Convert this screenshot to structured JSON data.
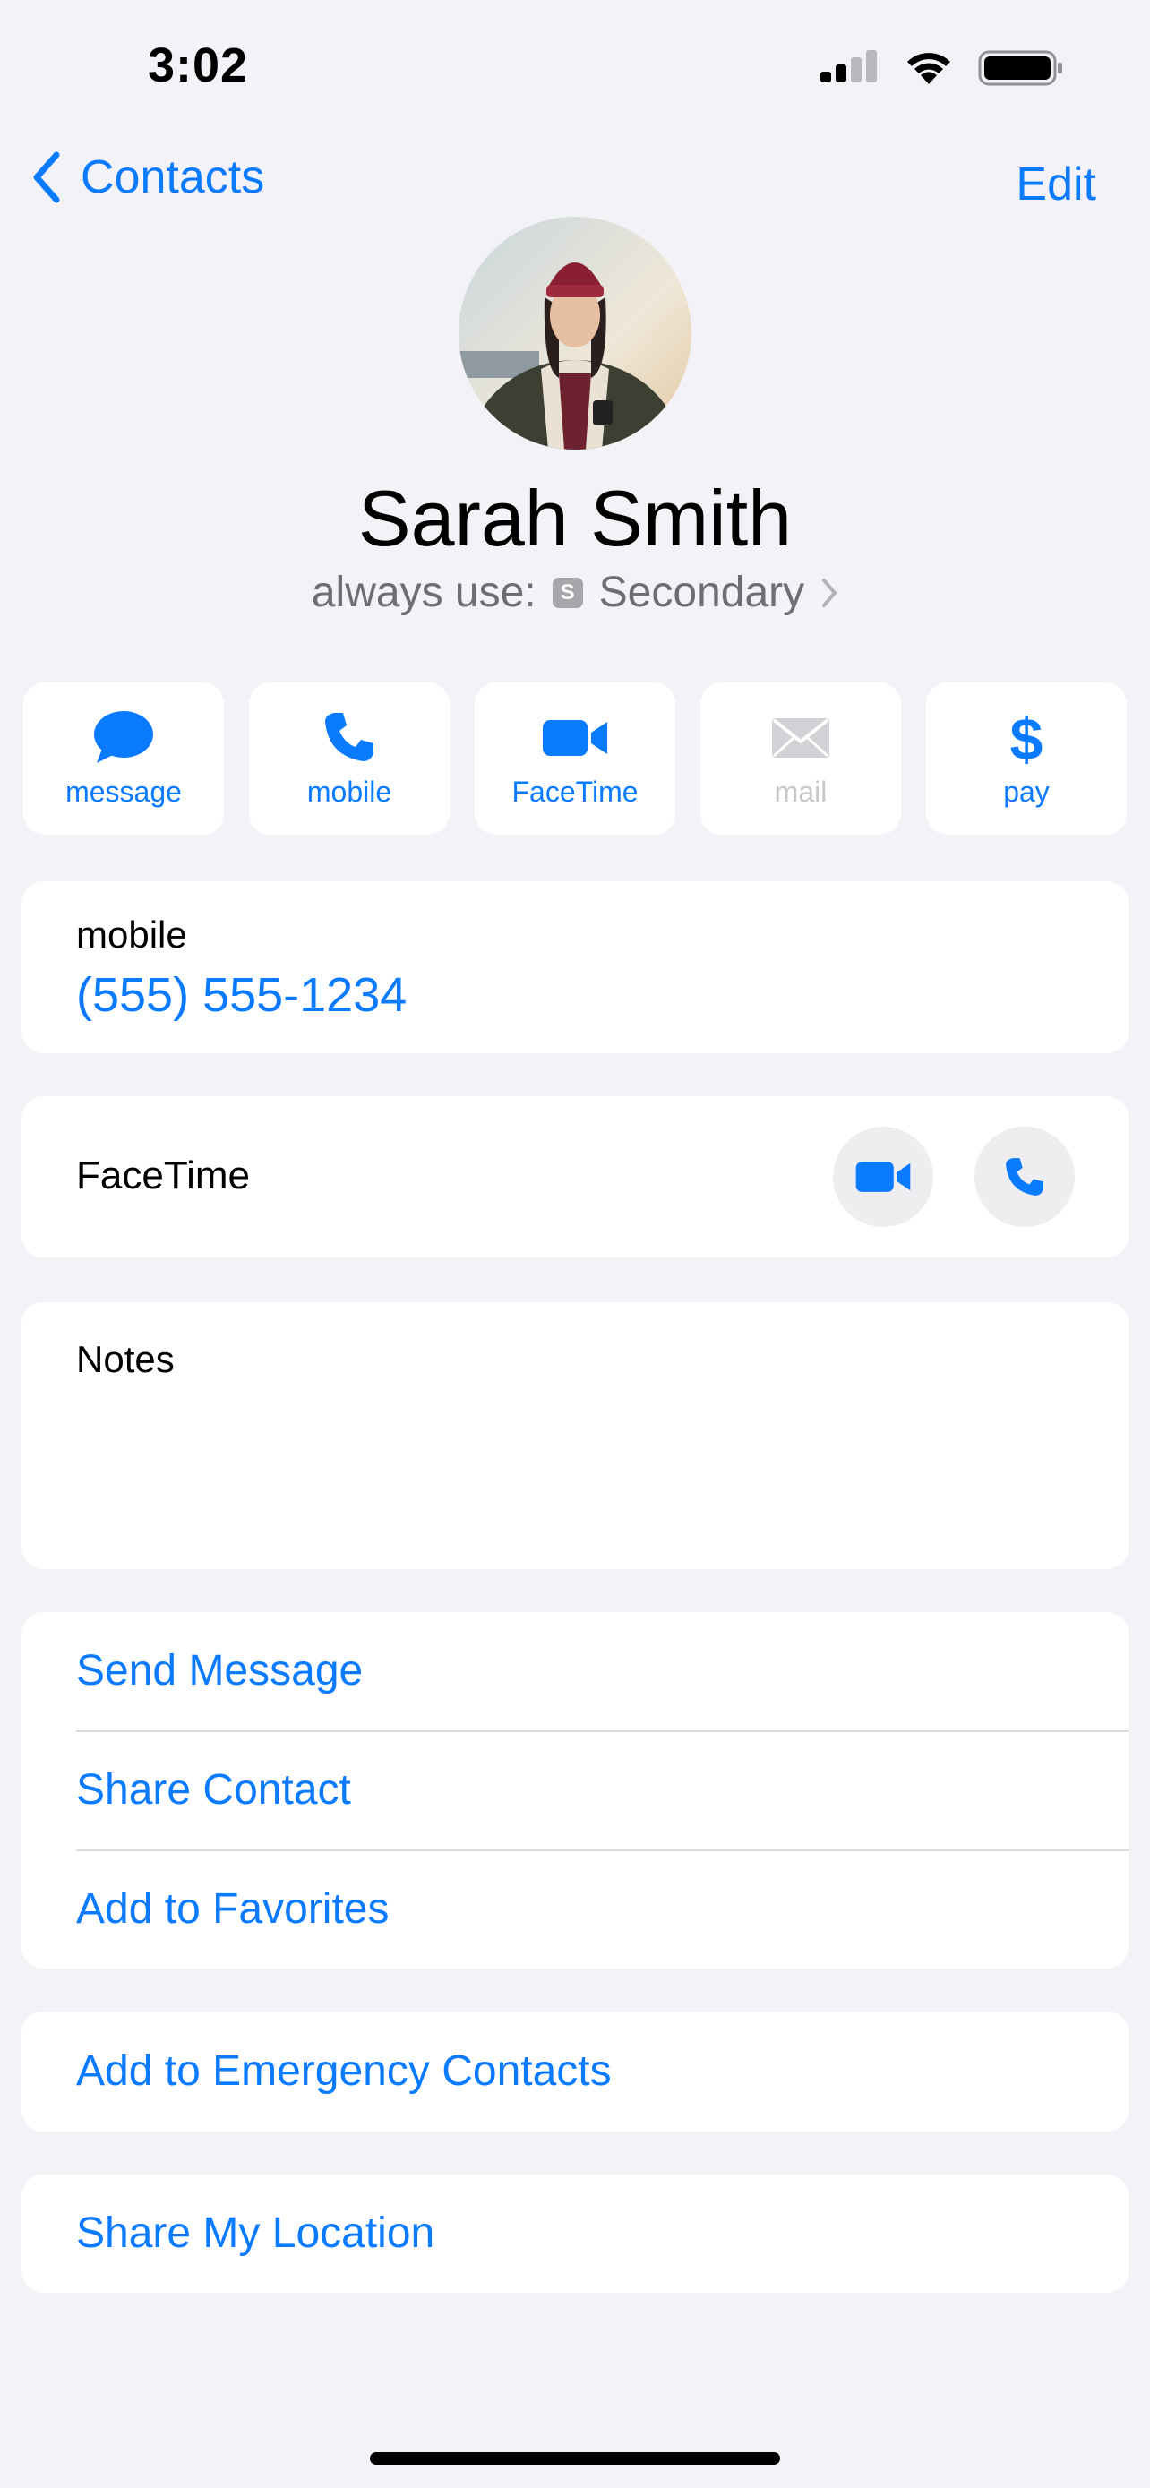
{
  "status_bar": {
    "time": "3:02"
  },
  "nav": {
    "back_label": "Contacts",
    "edit_label": "Edit"
  },
  "contact": {
    "name": "Sarah Smith",
    "always_use_label": "always use:",
    "sim_badge": "S",
    "sim_line": "Secondary"
  },
  "actions": [
    {
      "label": "message",
      "icon": "message-bubble-icon",
      "enabled": true
    },
    {
      "label": "mobile",
      "icon": "phone-icon",
      "enabled": true
    },
    {
      "label": "FaceTime",
      "icon": "video-camera-icon",
      "enabled": true
    },
    {
      "label": "mail",
      "icon": "envelope-icon",
      "enabled": false
    },
    {
      "label": "pay",
      "icon": "dollar-icon",
      "enabled": true
    }
  ],
  "phone": {
    "label": "mobile",
    "number": "(555) 555-1234"
  },
  "facetime": {
    "label": "FaceTime"
  },
  "notes": {
    "label": "Notes",
    "value": ""
  },
  "options_group": [
    "Send Message",
    "Share Contact",
    "Add to Favorites"
  ],
  "emergency": "Add to Emergency Contacts",
  "share_location": "Share My Location",
  "colors": {
    "accent": "#0a7aff",
    "background": "#f2f2f7",
    "secondary_text": "#6d6d72"
  }
}
